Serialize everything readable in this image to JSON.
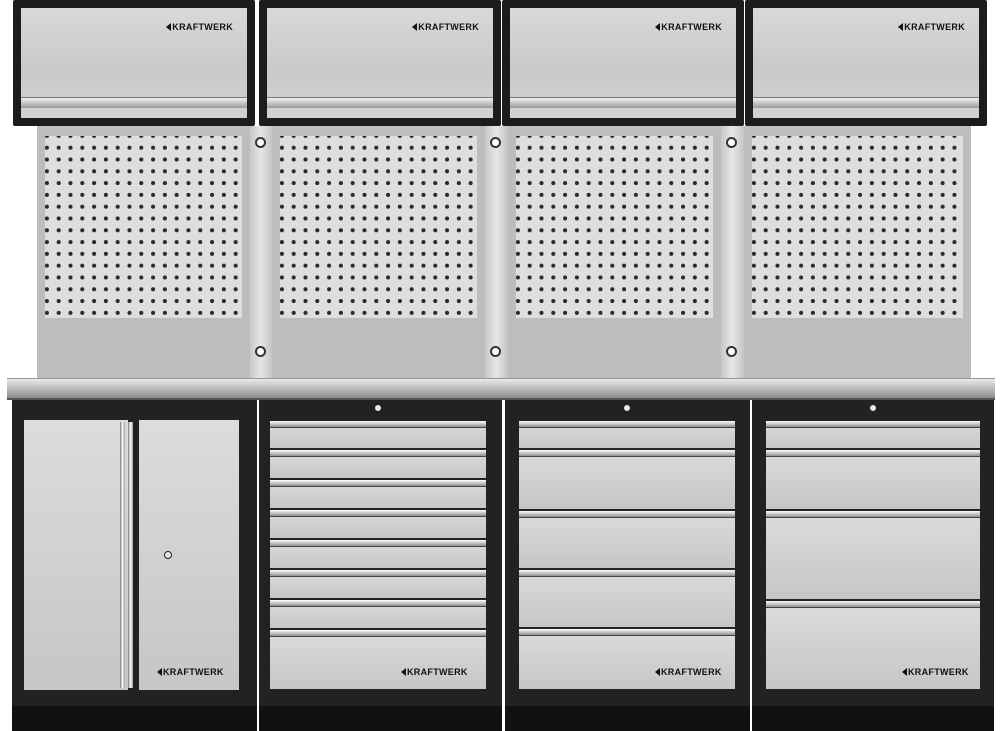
{
  "brand": "KRAFTWERK",
  "wall_cabinets": [
    "KRAFTWERK",
    "KRAFTWERK",
    "KRAFTWERK",
    "KRAFTWERK"
  ],
  "base_cabinets": {
    "door_cabinet_brand": "KRAFTWERK",
    "drawer_cabinet_1_brand": "KRAFTWERK",
    "drawer_cabinet_2_brand": "KRAFTWERK",
    "drawer_cabinet_3_brand": "KRAFTWERK",
    "drawer_counts": [
      8,
      5,
      5
    ]
  },
  "colors": {
    "frame": "#1c1c1c",
    "steel": "#d4d4d4",
    "pegboard": "#dedede"
  }
}
